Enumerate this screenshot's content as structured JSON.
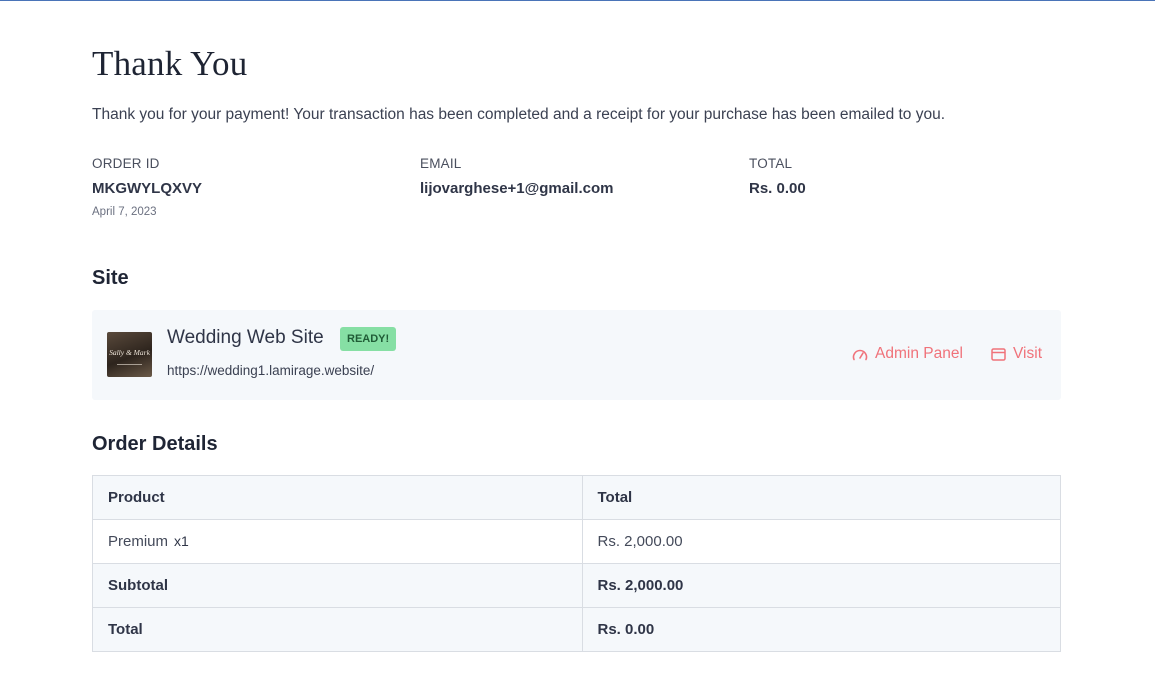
{
  "page": {
    "title": "Thank You",
    "intro": "Thank you for your payment! Your transaction has been completed and a receipt for your purchase has been emailed to you."
  },
  "order_summary": {
    "order_id": {
      "label": "ORDER ID",
      "value": "MKGWYLQXVY",
      "date": "April 7, 2023"
    },
    "email": {
      "label": "EMAIL",
      "value": "lijovarghese+1@gmail.com"
    },
    "total": {
      "label": "TOTAL",
      "value": "Rs. 0.00"
    }
  },
  "site_section": {
    "heading": "Site",
    "site": {
      "thumbnail_text": "Sally & Mark",
      "name": "Wedding Web Site",
      "status": "READY!",
      "url": "https://wedding1.lamirage.website/",
      "admin_label": "Admin Panel",
      "visit_label": "Visit",
      "admin_icon": "gauge-icon",
      "visit_icon": "browser-window-icon"
    }
  },
  "order_details": {
    "heading": "Order Details",
    "columns": [
      "Product",
      "Total"
    ],
    "items": [
      {
        "product": "Premium",
        "qty": "x1",
        "total": "Rs. 2,000.00"
      }
    ],
    "subtotal": {
      "label": "Subtotal",
      "value": "Rs. 2,000.00"
    },
    "total": {
      "label": "Total",
      "value": "Rs. 0.00"
    }
  },
  "colors": {
    "accent": "#f0727a",
    "ready_badge_bg": "#86dfa4",
    "card_bg": "#f5f8fb",
    "text": "#2f3547"
  }
}
